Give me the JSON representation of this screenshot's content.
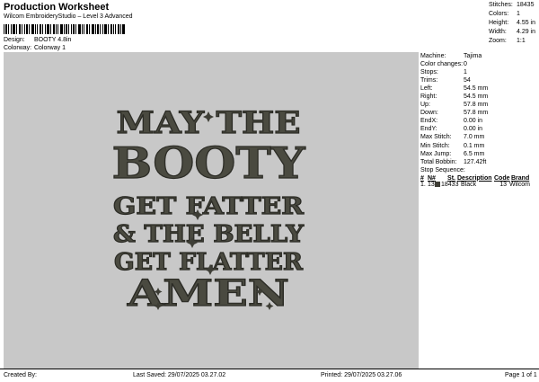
{
  "header": {
    "title": "Production Worksheet",
    "subtitle": "Wilcom EmbroideryStudio – Level 3 Advanced",
    "design_label": "Design:",
    "design_value": "BOOTY 4.8in",
    "colorway_label": "Colorway:",
    "colorway_value": "Colorway 1"
  },
  "stats": [
    {
      "label": "Stitches:",
      "value": "18435"
    },
    {
      "label": "Colors:",
      "value": "1"
    },
    {
      "label": "Height:",
      "value": "4.55 in"
    },
    {
      "label": "Width:",
      "value": "4.29 in"
    },
    {
      "label": "Zoom:",
      "value": "1:1"
    }
  ],
  "design_text": {
    "line1": "MAY THE",
    "line2": "BOOTY",
    "line3": "GET FATTER",
    "line4": "& THE BELLY",
    "line5": "GET FLATTER",
    "line6": "AMEN"
  },
  "properties": [
    {
      "label": "Machine:",
      "value": "Tajima"
    },
    {
      "label": "Color changes:",
      "value": "0"
    },
    {
      "label": "Stops:",
      "value": "1"
    },
    {
      "label": "Trims:",
      "value": "54"
    },
    {
      "label": "Left:",
      "value": "54.5 mm"
    },
    {
      "label": "Right:",
      "value": "54.5 mm"
    },
    {
      "label": "Up:",
      "value": "57.8 mm"
    },
    {
      "label": "Down:",
      "value": "57.8 mm"
    },
    {
      "label": "EndX:",
      "value": "0.00 in"
    },
    {
      "label": "EndY:",
      "value": "0.00 in"
    },
    {
      "label": "Max Stitch:",
      "value": "7.0 mm"
    },
    {
      "label": "Min Stitch:",
      "value": "0.1 mm"
    },
    {
      "label": "Max Jump:",
      "value": "6.5 mm"
    },
    {
      "label": "Total Bobbin:",
      "value": "127.42ft"
    }
  ],
  "stop_sequence": {
    "title": "Stop Sequence:",
    "headers": {
      "num": "#",
      "n": "N#",
      "st": "St.",
      "desc": "Description",
      "code": "Code",
      "brand": "Brand"
    },
    "rows": [
      {
        "num": "1.",
        "n": "13",
        "st": "18433",
        "desc": "Black",
        "code": "13",
        "brand": "Wilcom",
        "color": "#3e3d35"
      }
    ]
  },
  "footer": {
    "created_by": "Created By:",
    "last_saved": "Last Saved: 29/07/2025 03.27.02",
    "printed": "Printed: 29/07/2025 03.27.06",
    "page": "Page 1 of 1"
  }
}
